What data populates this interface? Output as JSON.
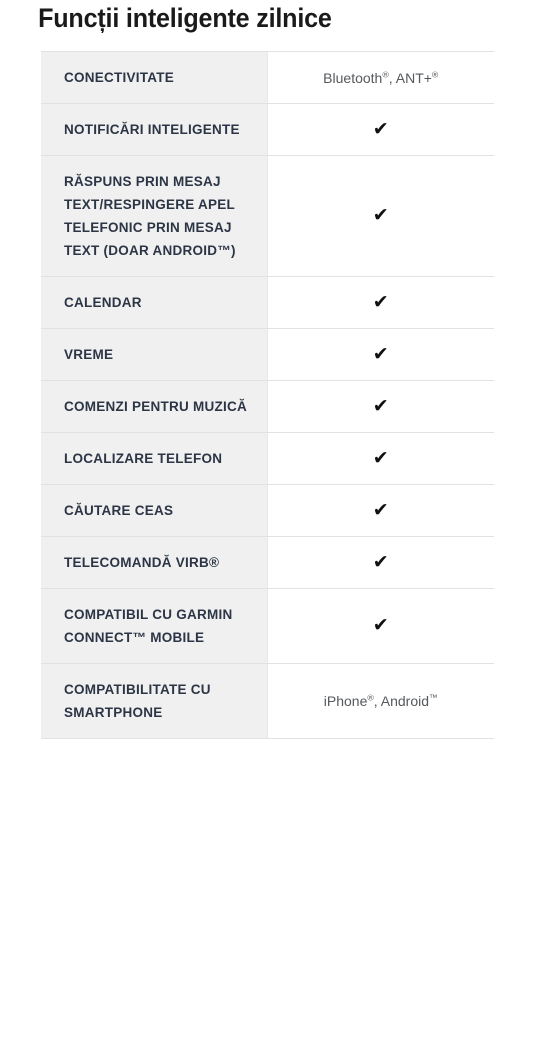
{
  "page": {
    "title": "Funcții inteligente zilnice",
    "background_color": "#ffffff",
    "label_bg_color": "#f0f0f0",
    "label_text_color": "#2c3545",
    "value_text_color": "#55595c",
    "border_color": "#e2e2e2",
    "check_color": "#111111"
  },
  "icons": {
    "check": "✔"
  },
  "table": {
    "rows": [
      {
        "label": "CONECTIVITATE",
        "value_type": "text",
        "value_parts": [
          {
            "text": "Bluetooth",
            "sup": "®"
          },
          {
            "text": ", ANT+",
            "sup": "®"
          }
        ],
        "value_text": "Bluetooth®, ANT+®"
      },
      {
        "label": "NOTIFICĂRI INTELIGENTE",
        "value_type": "check",
        "value_text": "✔"
      },
      {
        "label": "RĂSPUNS PRIN MESAJ TEXT/RESPINGERE APEL TELEFONIC PRIN MESAJ TEXT (DOAR ANDROID™)",
        "value_type": "check",
        "value_text": "✔"
      },
      {
        "label": "CALENDAR",
        "value_type": "check",
        "value_text": "✔"
      },
      {
        "label": "VREME",
        "value_type": "check",
        "value_text": "✔"
      },
      {
        "label": "COMENZI PENTRU MUZICĂ",
        "value_type": "check",
        "value_text": "✔"
      },
      {
        "label": "LOCALIZARE TELEFON",
        "value_type": "check",
        "value_text": "✔"
      },
      {
        "label": "CĂUTARE CEAS",
        "value_type": "check",
        "value_text": "✔"
      },
      {
        "label": "TELECOMANDĂ VIRB®",
        "value_type": "check",
        "value_text": "✔"
      },
      {
        "label": "COMPATIBIL CU GARMIN CONNECT™ MOBILE",
        "value_type": "check",
        "value_text": "✔"
      },
      {
        "label": "COMPATIBILITATE CU SMARTPHONE",
        "value_type": "text",
        "value_parts": [
          {
            "text": "iPhone",
            "sup": "®"
          },
          {
            "text": ", Android",
            "sup": "™"
          }
        ],
        "value_text": "iPhone®, Android™"
      }
    ]
  }
}
